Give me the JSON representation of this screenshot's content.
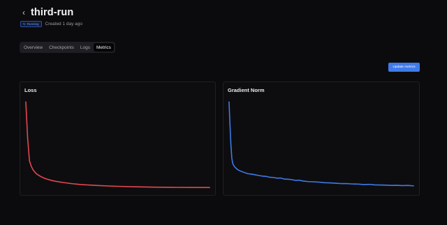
{
  "header": {
    "back_icon": "chevron-left-icon",
    "title": "third-run"
  },
  "meta": {
    "status": "Running",
    "status_icon": "running-icon",
    "status_color": "#6f98f0",
    "created": "Created 1 day ago"
  },
  "tabs": [
    {
      "label": "Overview",
      "active": false
    },
    {
      "label": "Checkpoints",
      "active": false
    },
    {
      "label": "Logs",
      "active": false
    },
    {
      "label": "Metrics",
      "active": true
    }
  ],
  "update_button": {
    "label": "Update metrics",
    "color": "#3f7be9"
  },
  "chart_data": [
    {
      "type": "line",
      "title": "Loss",
      "xlabel": "",
      "ylabel": "",
      "grid": false,
      "color": "#e5484d",
      "ylim": [
        0,
        1
      ],
      "x": [
        0,
        1,
        2,
        3,
        4,
        5,
        6,
        8,
        10,
        12,
        15,
        20,
        25,
        30,
        40,
        50,
        60,
        70,
        80,
        90,
        100
      ],
      "y": [
        0.95,
        0.55,
        0.3,
        0.24,
        0.2,
        0.175,
        0.155,
        0.13,
        0.11,
        0.097,
        0.08,
        0.063,
        0.05,
        0.04,
        0.028,
        0.02,
        0.015,
        0.011,
        0.009,
        0.008,
        0.007
      ]
    },
    {
      "type": "line",
      "title": "Gradient Norm",
      "xlabel": "",
      "ylabel": "",
      "grid": false,
      "color": "#3f7be9",
      "ylim": [
        0,
        1
      ],
      "x": [
        0,
        0.5,
        1,
        1.5,
        2,
        3,
        4,
        5,
        6,
        8,
        10,
        12,
        14,
        16,
        18,
        20,
        22,
        24,
        26,
        28,
        30,
        32,
        34,
        36,
        38,
        40,
        43,
        46,
        49,
        52,
        55,
        58,
        61,
        64,
        67,
        70,
        73,
        76,
        79,
        82,
        85,
        88,
        91,
        94,
        97,
        100
      ],
      "y": [
        0.95,
        0.7,
        0.48,
        0.33,
        0.27,
        0.235,
        0.215,
        0.2,
        0.19,
        0.175,
        0.16,
        0.155,
        0.148,
        0.14,
        0.133,
        0.13,
        0.12,
        0.118,
        0.11,
        0.112,
        0.1,
        0.098,
        0.094,
        0.085,
        0.088,
        0.079,
        0.072,
        0.07,
        0.066,
        0.06,
        0.058,
        0.054,
        0.05,
        0.05,
        0.046,
        0.045,
        0.04,
        0.042,
        0.036,
        0.035,
        0.033,
        0.03,
        0.031,
        0.028,
        0.03,
        0.025
      ]
    }
  ]
}
